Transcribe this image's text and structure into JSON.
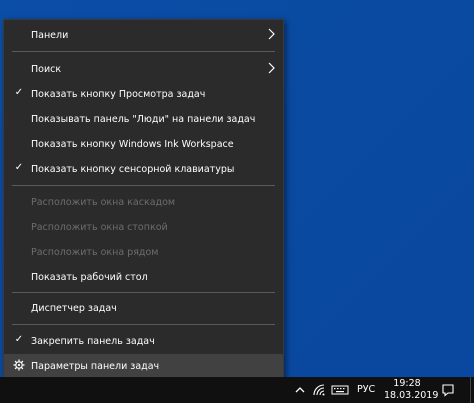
{
  "menu": {
    "items": [
      {
        "label": "Панели",
        "checked": false,
        "disabled": false,
        "submenu": true
      },
      {
        "label": "Поиск",
        "checked": false,
        "disabled": false,
        "submenu": true
      },
      {
        "label": "Показать кнопку Просмотра задач",
        "checked": true,
        "disabled": false,
        "submenu": false
      },
      {
        "label": "Показывать панель \"Люди\" на панели задач",
        "checked": false,
        "disabled": false,
        "submenu": false
      },
      {
        "label": "Показать кнопку Windows Ink Workspace",
        "checked": false,
        "disabled": false,
        "submenu": false
      },
      {
        "label": "Показать кнопку сенсорной клавиатуры",
        "checked": true,
        "disabled": false,
        "submenu": false
      },
      {
        "label": "Расположить окна каскадом",
        "checked": false,
        "disabled": true,
        "submenu": false
      },
      {
        "label": "Расположить окна стопкой",
        "checked": false,
        "disabled": true,
        "submenu": false
      },
      {
        "label": "Расположить окна рядом",
        "checked": false,
        "disabled": true,
        "submenu": false
      },
      {
        "label": "Показать рабочий стол",
        "checked": false,
        "disabled": false,
        "submenu": false
      },
      {
        "label": "Диспетчер задач",
        "checked": false,
        "disabled": false,
        "submenu": false
      },
      {
        "label": "Закрепить панель задач",
        "checked": true,
        "disabled": false,
        "submenu": false
      },
      {
        "label": "Параметры панели задач",
        "checked": false,
        "disabled": false,
        "submenu": false,
        "icon": "gear-icon",
        "highlighted": true
      }
    ]
  },
  "taskbar": {
    "language": "РУС",
    "time": "19:28",
    "date": "18.03.2019",
    "tray_icons": [
      "chevron-up-icon",
      "wifi-icon",
      "keyboard-icon",
      "speaker-icon",
      "notification-icon"
    ]
  },
  "colors": {
    "desktop": "#0a4aa0",
    "menu_bg": "#2b2b2b",
    "menu_hover": "#414141",
    "disabled_text": "#6d6d6d",
    "taskbar": "#101010"
  }
}
